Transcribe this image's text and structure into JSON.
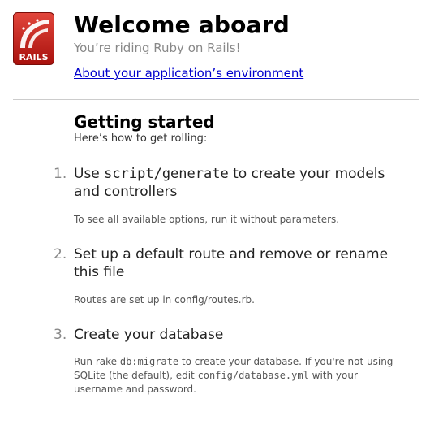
{
  "header": {
    "logo_text": "RAILS",
    "title": "Welcome aboard",
    "subtitle": "You’re riding Ruby on Rails!",
    "env_link": "About your application’s environment"
  },
  "getting_started": {
    "heading": "Getting started",
    "intro": "Here’s how to get rolling:",
    "steps": [
      {
        "number": "1.",
        "title_pre": "Use ",
        "title_code": "script/generate",
        "title_post": " to create your models and controllers",
        "desc": "To see all available options, run it without parameters."
      },
      {
        "number": "2.",
        "title": "Set up a default route and remove or rename this file",
        "desc": "Routes are set up in config/routes.rb."
      },
      {
        "number": "3.",
        "title": "Create your database",
        "desc_pre": "Run rake ",
        "desc_code1": "db:migrate",
        "desc_mid": " to create your database. If you're not using SQLite (the default), edit ",
        "desc_code2": "config/database.yml",
        "desc_post": " with your username and password."
      }
    ]
  },
  "colors": {
    "logo_red": "#c6201a",
    "link": "#0000cc",
    "muted": "#888888"
  }
}
